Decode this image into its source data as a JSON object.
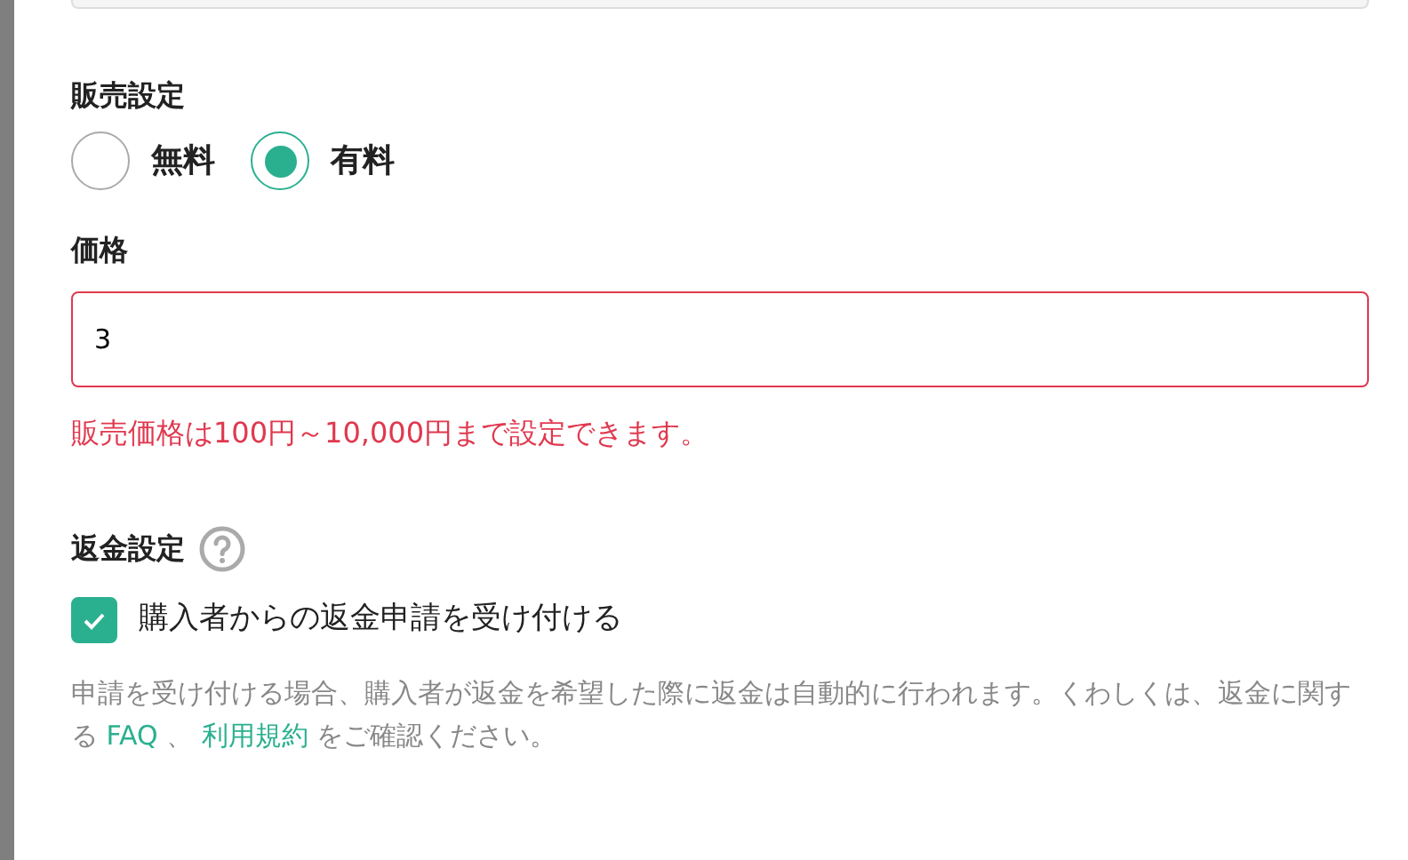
{
  "sale_setting": {
    "label": "販売設定",
    "options": [
      {
        "label": "無料",
        "selected": false
      },
      {
        "label": "有料",
        "selected": true
      }
    ]
  },
  "price": {
    "label": "価格",
    "value": "3",
    "error": "販売価格は100円～10,000円まで設定できます。"
  },
  "refund": {
    "label": "返金設定",
    "checkbox": {
      "label": "購入者からの返金申請を受け付ける",
      "checked": true
    },
    "note": [
      {
        "kind": "text",
        "text": "申請を受け付ける場合、購入者が返金を希望した際に返金は自動的に行われます。くわしくは、返金に関する "
      },
      {
        "kind": "link",
        "text": "FAQ"
      },
      {
        "kind": "text",
        "text": " 、 "
      },
      {
        "kind": "link",
        "text": "利用規約"
      },
      {
        "kind": "text",
        "text": " をご確認ください。"
      }
    ]
  }
}
